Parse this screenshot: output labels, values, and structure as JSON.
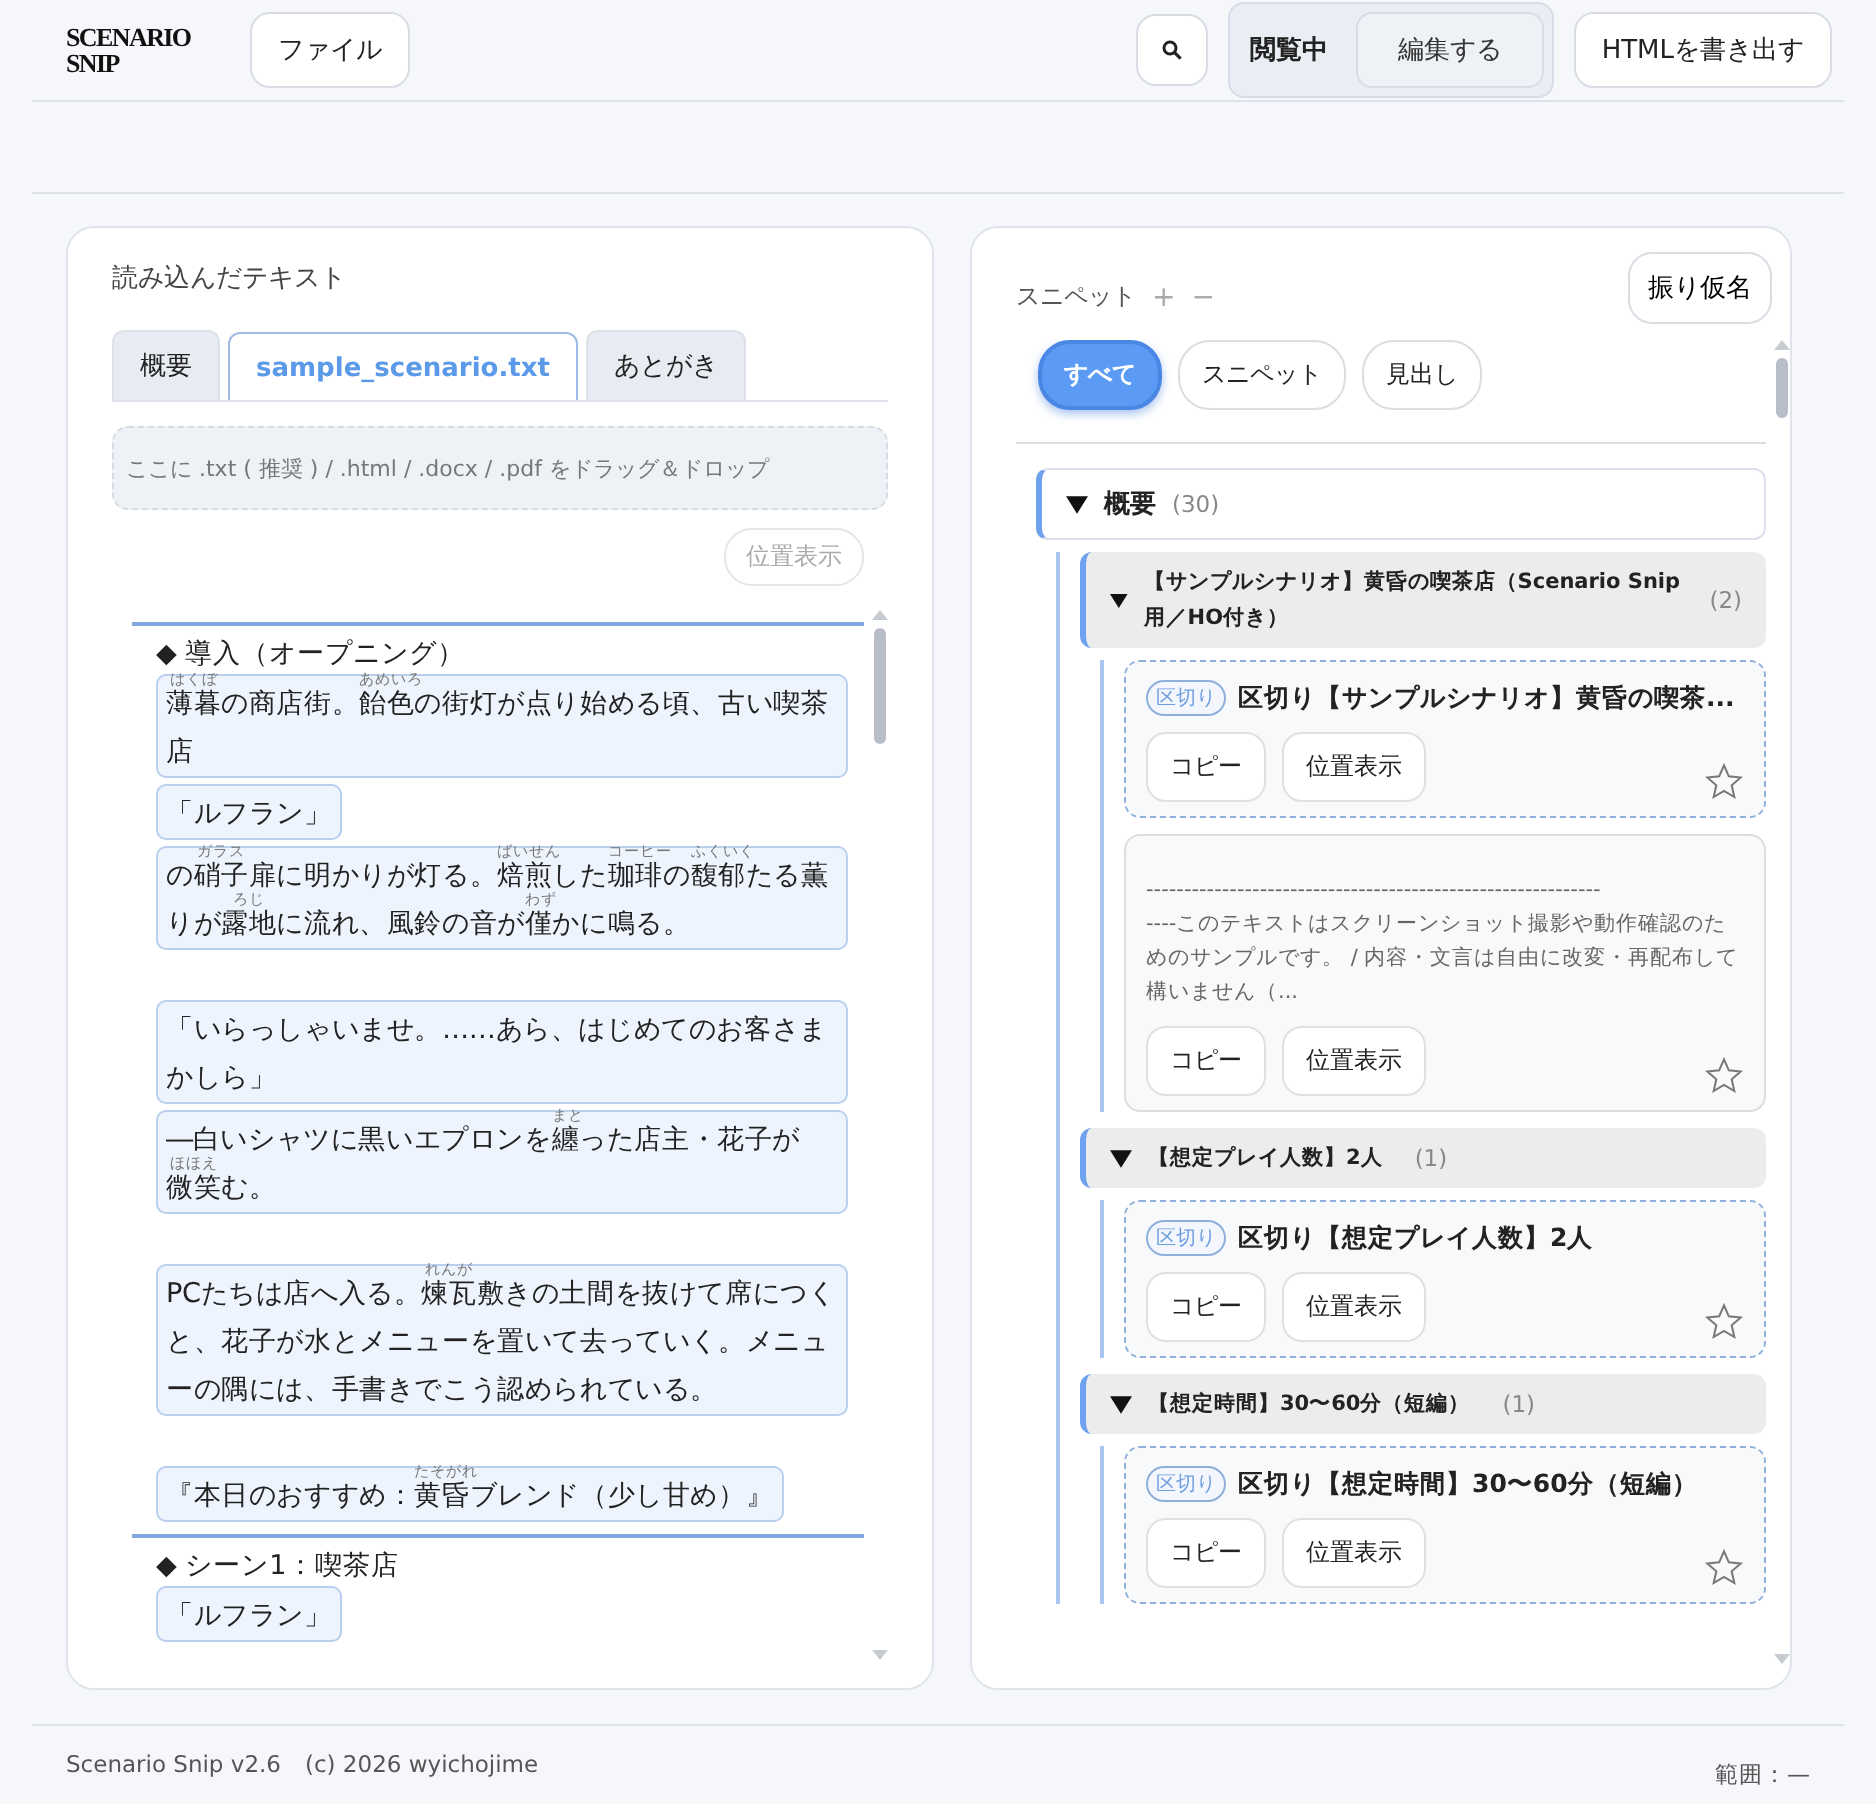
{
  "logo": {
    "line1": "SCENARIO",
    "line2": "SNIP"
  },
  "header": {
    "file_button": "ファイル",
    "mode_options": [
      {
        "label": "閲覧中",
        "selected": true
      },
      {
        "label": "編集する",
        "selected": false
      }
    ],
    "export_button": "HTMLを書き出す"
  },
  "left_panel": {
    "title": "読み込んだテキスト",
    "tabs": [
      {
        "label": "概要",
        "selected": false
      },
      {
        "label": "sample_scenario.txt",
        "selected": true
      },
      {
        "label": "あとがき",
        "selected": false
      }
    ],
    "drop_zone": {
      "placeholder": "ここに .txt ( 推奨 ) / .html / .docx / .pdf をドラッグ＆ドロップ"
    },
    "locate_button": {
      "label": "位置表示",
      "disabled": true
    },
    "items": [
      {
        "kind": "heading",
        "text": "◆ 導入（オープニング）"
      },
      {
        "kind": "para",
        "segments": [
          {
            "text": "薄暮",
            "ruby": "はくぼ"
          },
          {
            "text": "の商店街。"
          },
          {
            "text": "飴色",
            "ruby": "あめいろ"
          },
          {
            "text": "の街灯が点り始める頃、古い喫茶店"
          }
        ]
      },
      {
        "kind": "para",
        "segments": [
          {
            "text": "「ルフラン」"
          }
        ]
      },
      {
        "kind": "para",
        "segments": [
          {
            "text": "の"
          },
          {
            "text": "硝子",
            "ruby": "ガラス"
          },
          {
            "text": "扉に明かりが灯る。"
          },
          {
            "text": "焙煎",
            "ruby": "ばいせん"
          },
          {
            "text": "した"
          },
          {
            "text": "珈琲",
            "ruby": "コーヒー"
          },
          {
            "text": "の"
          },
          {
            "text": "馥郁",
            "ruby": "ふくいく"
          },
          {
            "text": "たる薫りが"
          },
          {
            "text": "露地",
            "ruby": "ろじ"
          },
          {
            "text": "に流れ、風鈴の音が"
          },
          {
            "text": "僅",
            "ruby": "わず"
          },
          {
            "text": "かに鳴る。"
          }
        ]
      },
      {
        "kind": "spacer"
      },
      {
        "kind": "para",
        "segments": [
          {
            "text": "「いらっしゃいませ。……あら、はじめてのお客さまかしら」"
          }
        ]
      },
      {
        "kind": "para",
        "segments": [
          {
            "text": "―白いシャツに黒いエプロンを"
          },
          {
            "text": "纏",
            "ruby": "まと"
          },
          {
            "text": "った店主・花子が"
          },
          {
            "text": "微笑",
            "ruby": "ほほえ"
          },
          {
            "text": "む。"
          }
        ]
      },
      {
        "kind": "spacer"
      },
      {
        "kind": "para",
        "segments": [
          {
            "text": "PCたちは店へ入る。"
          },
          {
            "text": "煉瓦",
            "ruby": "れんが"
          },
          {
            "text": "敷きの土間を抜けて席につくと、花子が水とメニューを置いて去っていく。メニューの隅には、手書きでこう認められている。"
          }
        ]
      },
      {
        "kind": "spacer"
      },
      {
        "kind": "para",
        "segments": [
          {
            "text": "『本日のおすすめ："
          },
          {
            "text": "黄昏",
            "ruby": "たそがれ"
          },
          {
            "text": "ブレンド（少し甘め）』"
          }
        ]
      },
      {
        "kind": "heading",
        "text": "◆ シーン1：喫茶店"
      },
      {
        "kind": "para",
        "segments": [
          {
            "text": "「ルフラン」"
          }
        ]
      }
    ]
  },
  "right_panel": {
    "title": "スニペット",
    "title_actions": [
      "+",
      "−"
    ],
    "furigana_button": "振り仮名",
    "filters": [
      {
        "label": "すべて",
        "selected": true
      },
      {
        "label": "スニペット",
        "selected": false
      },
      {
        "label": "見出し",
        "selected": false
      }
    ],
    "tree": [
      {
        "label": "概要",
        "count": "(30)",
        "expanded": true,
        "children": [
          {
            "label": "【サンプルシナリオ】黄昏の喫茶店（Scenario Snip 用／HO付き）",
            "count": "(2)",
            "expanded": true,
            "cards": [
              {
                "kind": "divider",
                "badge": "区切り",
                "title": "区切り【サンプルシナリオ】黄昏の喫茶...",
                "buttons": [
                  "コピー",
                  "位置表示"
                ],
                "starred": false
              },
              {
                "kind": "text",
                "lines": [
                  "------------------------------------------------------------",
                  "----このテキストはスクリーンショット撮影や動作確認のためのサンプルです。 / 内容・文言は自由に改変・再配布して構いません（..."
                ],
                "buttons": [
                  "コピー",
                  "位置表示"
                ],
                "starred": false
              }
            ]
          },
          {
            "label": "【想定プレイ人数】2人",
            "count": "(1)",
            "expanded": true,
            "cards": [
              {
                "kind": "divider",
                "badge": "区切り",
                "title": "区切り【想定プレイ人数】2人",
                "buttons": [
                  "コピー",
                  "位置表示"
                ],
                "starred": false
              }
            ]
          },
          {
            "label": "【想定時間】30〜60分（短編）",
            "count": "(1)",
            "expanded": true,
            "cards": [
              {
                "kind": "divider",
                "badge": "区切り",
                "title": "区切り【想定時間】30〜60分（短編）",
                "buttons": [
                  "コピー",
                  "位置表示"
                ],
                "starred": false
              }
            ]
          }
        ]
      }
    ]
  },
  "footer": {
    "version": "Scenario Snip v2.6",
    "copyright": "(c) 2026 wyichojime",
    "range": "範囲：—"
  }
}
